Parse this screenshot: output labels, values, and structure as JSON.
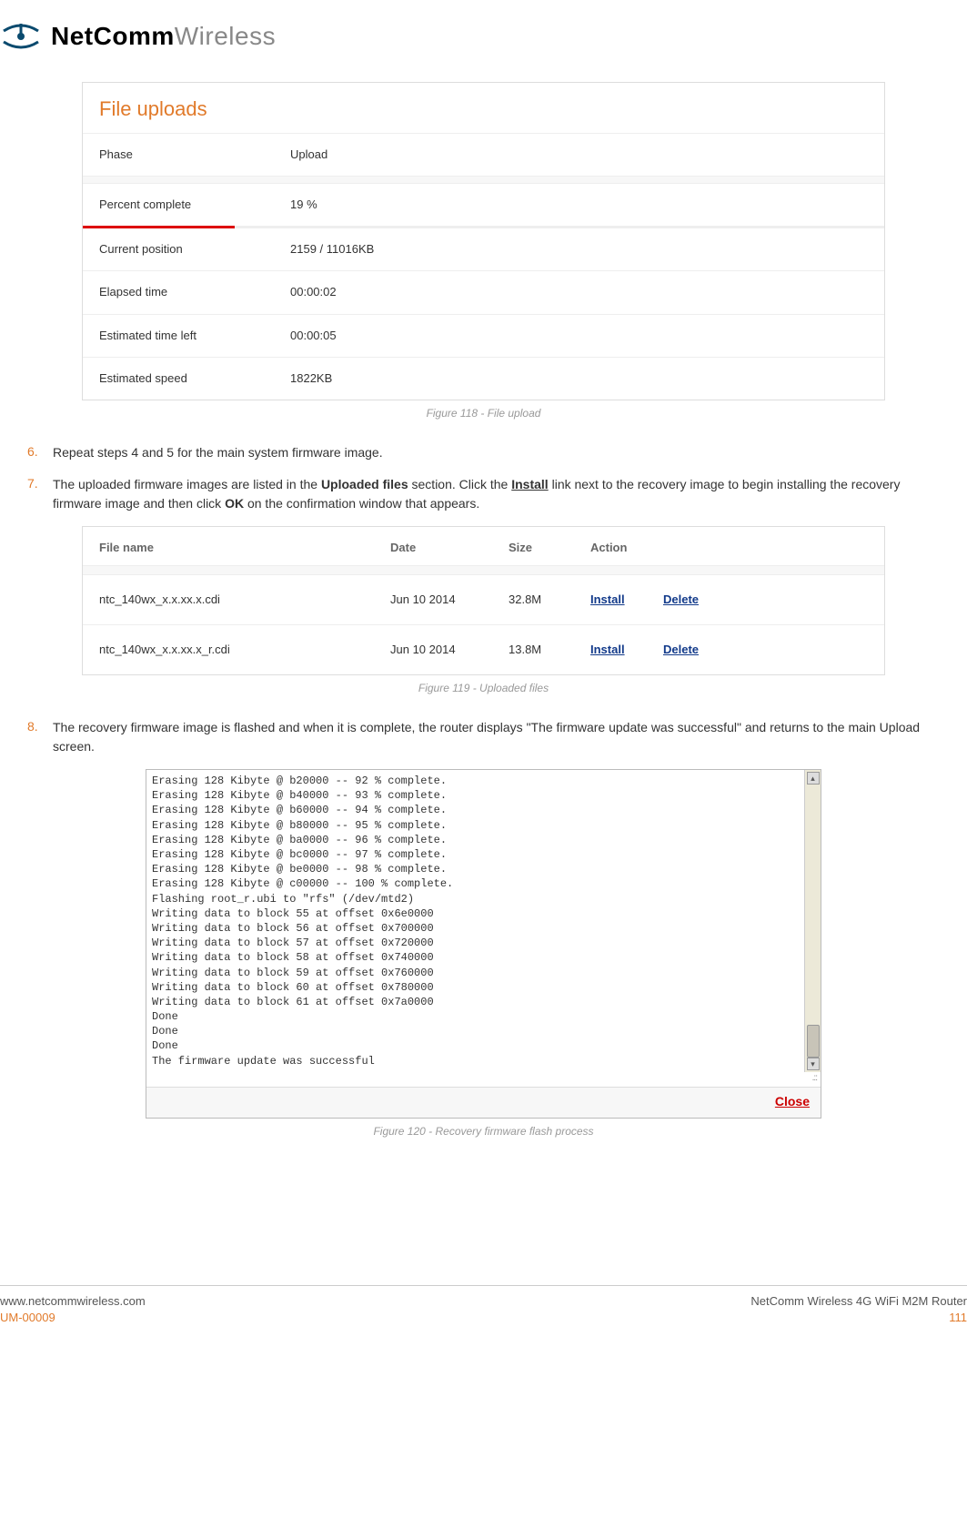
{
  "brand": {
    "bold": "NetComm",
    "light": "Wireless"
  },
  "upload_panel": {
    "title": "File uploads",
    "rows": {
      "phase_label": "Phase",
      "phase_value": "Upload",
      "percent_label": "Percent complete",
      "percent_value": "19 %",
      "position_label": "Current position",
      "position_value": "2159 / 11016KB",
      "elapsed_label": "Elapsed time",
      "elapsed_value": "00:00:02",
      "remaining_label": "Estimated time left",
      "remaining_value": "00:00:05",
      "speed_label": "Estimated speed",
      "speed_value": "1822KB"
    },
    "progress_percent": 19
  },
  "captions": {
    "fig118": "Figure 118 - File upload",
    "fig119": "Figure 119 - Uploaded files",
    "fig120": "Figure 120 - Recovery firmware flash process"
  },
  "steps": {
    "s6": "Repeat steps 4 and 5 for the main system firmware image.",
    "s7_a": "The uploaded firmware images are listed in the ",
    "s7_b": "Uploaded files",
    "s7_c": " section. Click the ",
    "s7_d": "Install",
    "s7_e": " link next to the recovery image to begin installing the recovery firmware image and then click ",
    "s7_f": "OK",
    "s7_g": " on the confirmation window that appears.",
    "s8": "The recovery firmware image is flashed and when it is complete, the router displays \"The firmware update was successful\" and returns to the main Upload screen."
  },
  "files_table": {
    "headers": {
      "name": "File name",
      "date": "Date",
      "size": "Size",
      "action": "Action"
    },
    "rows": [
      {
        "name": "ntc_140wx_x.x.xx.x.cdi",
        "date": "Jun 10 2014",
        "size": "32.8M",
        "install": "Install",
        "delete": "Delete"
      },
      {
        "name": "ntc_140wx_x.x.xx.x_r.cdi",
        "date": "Jun 10 2014",
        "size": "13.8M",
        "install": "Install",
        "delete": "Delete"
      }
    ]
  },
  "console": {
    "text": "Erasing 128 Kibyte @ b20000 -- 92 % complete.\nErasing 128 Kibyte @ b40000 -- 93 % complete.\nErasing 128 Kibyte @ b60000 -- 94 % complete.\nErasing 128 Kibyte @ b80000 -- 95 % complete.\nErasing 128 Kibyte @ ba0000 -- 96 % complete.\nErasing 128 Kibyte @ bc0000 -- 97 % complete.\nErasing 128 Kibyte @ be0000 -- 98 % complete.\nErasing 128 Kibyte @ c00000 -- 100 % complete.\nFlashing root_r.ubi to \"rfs\" (/dev/mtd2)\nWriting data to block 55 at offset 0x6e0000\nWriting data to block 56 at offset 0x700000\nWriting data to block 57 at offset 0x720000\nWriting data to block 58 at offset 0x740000\nWriting data to block 59 at offset 0x760000\nWriting data to block 60 at offset 0x780000\nWriting data to block 61 at offset 0x7a0000\nDone\nDone\nDone\nThe firmware update was successful",
    "close": "Close"
  },
  "footer": {
    "url": "www.netcommwireless.com",
    "um": "UM-00009",
    "product": "NetComm Wireless 4G WiFi M2M Router",
    "page": "111"
  }
}
